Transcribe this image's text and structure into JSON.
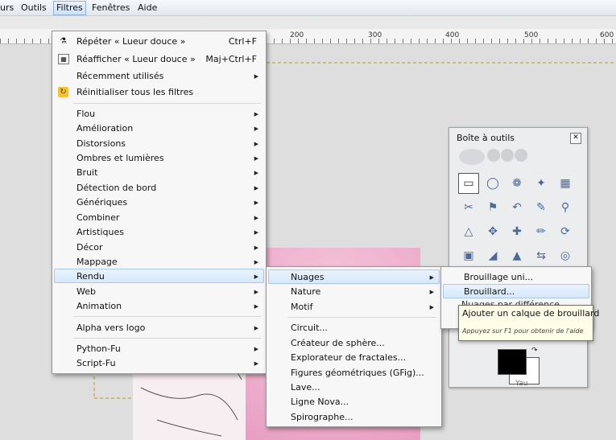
{
  "menubar": {
    "items": [
      "urs",
      "Outils",
      "Filtres",
      "Fenêtres",
      "Aide"
    ]
  },
  "ruler": {
    "labels": [
      "200",
      "300",
      "400",
      "500",
      "600"
    ]
  },
  "filters_menu": {
    "items": [
      {
        "label": "Répéter « Lueur douce »",
        "shortcut": "Ctrl+F",
        "icon": "repeat-filter-icon"
      },
      {
        "label": "Réafficher « Lueur douce »",
        "shortcut": "Maj+Ctrl+F",
        "icon": "reshow-filter-icon"
      },
      {
        "label": "Récemment utilisés",
        "submenu": true
      },
      {
        "label": "Réinitialiser tous les filtres",
        "icon": "reset-filters-icon"
      },
      {
        "label": "Flou",
        "submenu": true
      },
      {
        "label": "Amélioration",
        "submenu": true
      },
      {
        "label": "Distorsions",
        "submenu": true
      },
      {
        "label": "Ombres et lumières",
        "submenu": true
      },
      {
        "label": "Bruit",
        "submenu": true
      },
      {
        "label": "Détection de bord",
        "submenu": true
      },
      {
        "label": "Génériques",
        "submenu": true
      },
      {
        "label": "Combiner",
        "submenu": true
      },
      {
        "label": "Artistiques",
        "submenu": true
      },
      {
        "label": "Décor",
        "submenu": true
      },
      {
        "label": "Mappage",
        "submenu": true
      },
      {
        "label": "Rendu",
        "submenu": true,
        "highlighted": true
      },
      {
        "label": "Web",
        "submenu": true
      },
      {
        "label": "Animation",
        "submenu": true
      },
      {
        "label": "Alpha vers logo",
        "submenu": true
      },
      {
        "label": "Python-Fu",
        "submenu": true
      },
      {
        "label": "Script-Fu",
        "submenu": true
      }
    ]
  },
  "render_menu": {
    "items": [
      {
        "label": "Nuages",
        "submenu": true,
        "highlighted": true
      },
      {
        "label": "Nature",
        "submenu": true
      },
      {
        "label": "Motif",
        "submenu": true
      },
      {
        "label": "Circuit..."
      },
      {
        "label": "Créateur de sphère..."
      },
      {
        "label": "Explorateur de fractales..."
      },
      {
        "label": "Figures géométriques (GFig)..."
      },
      {
        "label": "Lave..."
      },
      {
        "label": "Ligne Nova..."
      },
      {
        "label": "Spirographe..."
      }
    ]
  },
  "clouds_menu": {
    "items": [
      {
        "label": "Brouillage uni..."
      },
      {
        "label": "Brouillard...",
        "highlighted": true
      }
    ],
    "partial_item": "Nuages par différence..."
  },
  "tooltip": {
    "text": "Ajouter un calque de brouillard",
    "hint": "Appuyez sur F1 pour obtenir de l'aide"
  },
  "toolbox": {
    "title": "Boîte à outils",
    "close_icon": "close-icon",
    "tools": [
      "rect-select-icon",
      "ellipse-select-icon",
      "lasso-icon",
      "magic-wand-icon",
      "color-select-icon",
      "scissors-icon",
      "foreground-select-icon",
      "paths-icon",
      "color-picker-icon",
      "zoom-icon",
      "measure-icon",
      "move-icon",
      "align-icon",
      "crop-icon",
      "rotate-icon",
      "scale-icon",
      "shear-icon",
      "perspective-icon",
      "flip-icon",
      "cage-icon"
    ],
    "foreground_color": "#000000",
    "background_color": "#ffffff",
    "footer_label": "Yau"
  }
}
